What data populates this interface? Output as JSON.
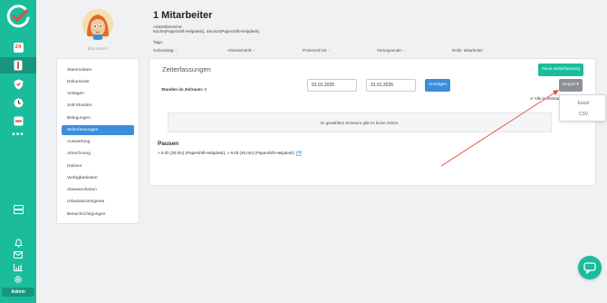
{
  "sidebar": {
    "calendar_day": "24",
    "admin_label": "Admin",
    "more_label": "•••"
  },
  "profile": {
    "avatar_caption": "Bild ändern",
    "name": "1 Mitarbeiter",
    "work_areas_label": "Arbeitsbereiche:",
    "work_areas_value": "Küche(Papershift-Helpdesk), Service(Papershift-Helpdesk)",
    "tags_label": "Tags:",
    "birthday": "Geburtstag: -",
    "entry": "Arbeitseintritt: -",
    "probation": "Probezeit bis: -",
    "contract_end": "Vertragsende: -",
    "role": "Rolle: Mitarbeiter"
  },
  "menu": {
    "items": [
      {
        "label": "Stammdaten"
      },
      {
        "label": "Dokumente"
      },
      {
        "label": "Vorlagen"
      },
      {
        "label": "Soll-Stunden"
      },
      {
        "label": "Belegungen"
      },
      {
        "label": "Zeiterfassungen"
      },
      {
        "label": "Auswertung"
      },
      {
        "label": "Abrechnung"
      },
      {
        "label": "Notizen"
      },
      {
        "label": "Verfügbarkeiten"
      },
      {
        "label": "Abwesenheiten"
      },
      {
        "label": "Urlaubskontingente"
      },
      {
        "label": "Benachrichtigungen"
      }
    ],
    "active_index": 5
  },
  "main": {
    "title": "Zeiterfassungen",
    "new_button": "Neue Zeiterfassung",
    "hours_label": "Stunden im Zeitraum:",
    "hours_value": "0",
    "date_from": "01.01.2026",
    "date_to": "31.01.2026",
    "show_button": "Anzeigen",
    "export_button": "Export ▾",
    "export_options": [
      "Excel",
      "CSV"
    ],
    "show_all": "✔ Alle in Zeitraum",
    "empty_message": "Im gewählten Zeitraum gibt es keine Zeiten.",
    "breaks_title": "Pausen",
    "breaks_text": "> 6.0h (30.0m) (Papershift-Helpdesk), > 9.0h (45.0m) (Papershift-Helpdesk)"
  },
  "colors": {
    "sidebar": "#1abc9c",
    "primary": "#3b8ede",
    "success": "#1abc9c",
    "arrow": "#e74c3c"
  }
}
